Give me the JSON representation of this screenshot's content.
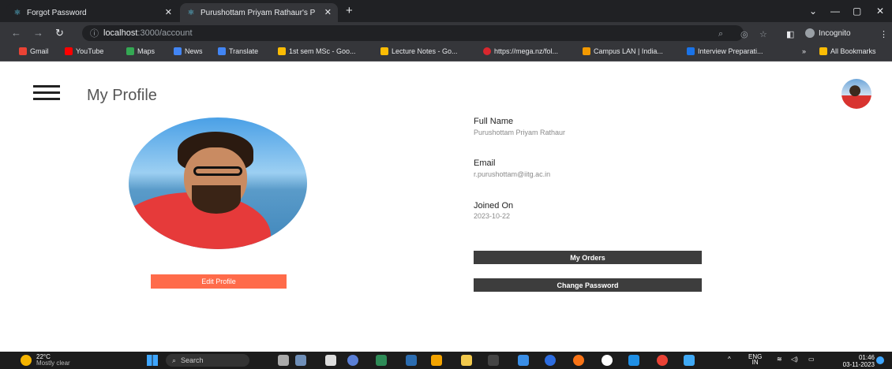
{
  "browser": {
    "tabs": [
      {
        "title": "Forgot Password",
        "active": false
      },
      {
        "title": "Purushottam Priyam Rathaur's P",
        "active": true
      }
    ],
    "url_host": "localhost",
    "url_path": ":3000/account",
    "incognito_label": "Incognito",
    "bookmarks": [
      "Gmail",
      "YouTube",
      "Maps",
      "News",
      "Translate",
      "1st sem MSc - Goo...",
      "Lecture Notes - Go...",
      "https://mega.nz/fol...",
      "Campus LAN | India...",
      "Interview Preparati..."
    ],
    "all_bookmarks": "All Bookmarks"
  },
  "page": {
    "title": "My Profile",
    "edit_profile_label": "Edit Profile",
    "fields": {
      "full_name_label": "Full Name",
      "full_name_value": "Purushottam Priyam Rathaur",
      "email_label": "Email",
      "email_value": "r.purushottam@iitg.ac.in",
      "joined_label": "Joined On",
      "joined_value": "2023-10-22"
    },
    "my_orders_label": "My Orders",
    "change_password_label": "Change Password",
    "accent_color": "#ff6b4a",
    "dark_button_color": "#3d3d3d"
  },
  "taskbar": {
    "temperature": "22°C",
    "weather": "Mostly clear",
    "search_placeholder": "Search",
    "lang_primary": "ENG",
    "lang_secondary": "IN",
    "time": "01:46",
    "date": "03-11-2023"
  }
}
